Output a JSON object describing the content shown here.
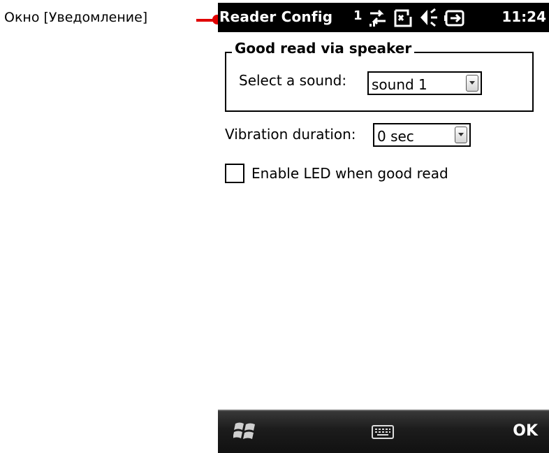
{
  "annotation": {
    "label": "Окно [Уведомление]"
  },
  "status_bar": {
    "app_title": "Reader Config",
    "signal": "1",
    "time": "11:24",
    "icons": [
      "connectivity-icon",
      "notification-icon",
      "speaker-icon",
      "battery-icon"
    ]
  },
  "sound_group": {
    "title": "Good read via speaker",
    "select_label": "Select a sound:",
    "select_value": "sound 1"
  },
  "vibration": {
    "label": "Vibration duration:",
    "value": "0 sec"
  },
  "led": {
    "label": "Enable LED when good read",
    "checked": false
  },
  "menu_bar": {
    "left_icon": "windows-start-icon",
    "center_icon": "keyboard-icon",
    "right_label": "OK"
  },
  "colors": {
    "annotation": "#e00000",
    "bars": "#000000"
  }
}
